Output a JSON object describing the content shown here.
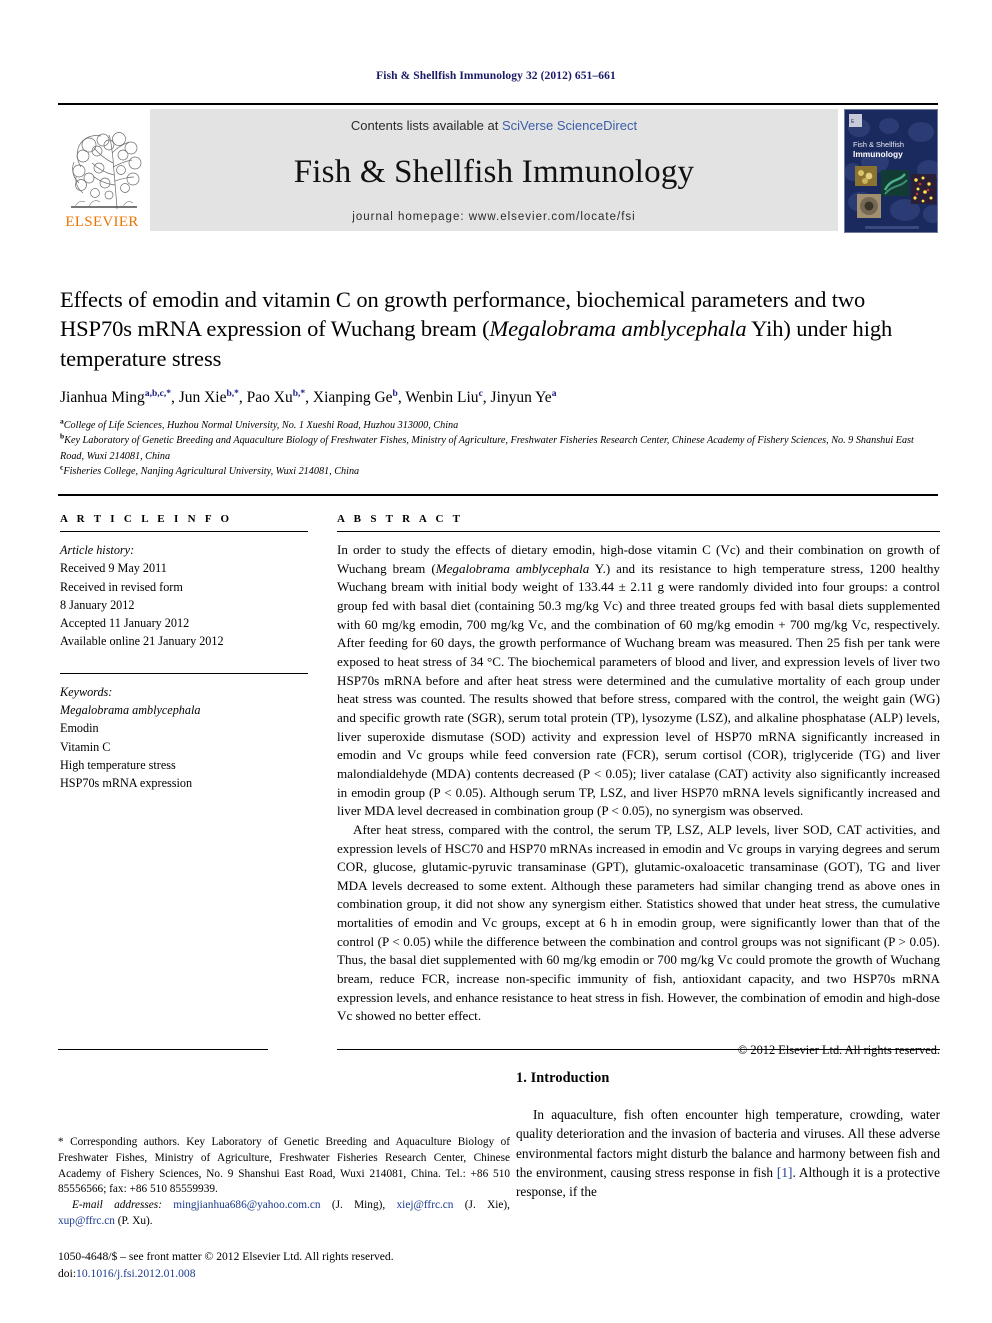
{
  "running_head": "Fish & Shellfish Immunology 32 (2012) 651–661",
  "masthead": {
    "publisher_name": "ELSEVIER",
    "contents_prefix": "Contents lists available at ",
    "contents_link": "SciVerse ScienceDirect",
    "journal_title": "Fish & Shellfish Immunology",
    "homepage_label": "journal homepage: www.elsevier.com/locate/fsi",
    "cover_title_line1": "Fish & Shellfish",
    "cover_title_line2": "Immunology"
  },
  "title": {
    "line1": "Effects of emodin and vitamin C on growth performance, biochemical parameters",
    "line2_pre": "and two HSP70s mRNA expression of Wuchang bream (",
    "line2_italic": "Megalobrama",
    "line3_italic": "amblycephala",
    "line3_post": " Yih) under high temperature stress"
  },
  "authors": [
    {
      "name": "Jianhua Ming",
      "sup": "a,b,c,*"
    },
    {
      "name": "Jun Xie",
      "sup": "b,*"
    },
    {
      "name": "Pao Xu",
      "sup": "b,*"
    },
    {
      "name": "Xianping Ge",
      "sup": "b"
    },
    {
      "name": "Wenbin Liu",
      "sup": "c"
    },
    {
      "name": "Jinyun Ye",
      "sup": "a"
    }
  ],
  "affiliations": [
    {
      "mark": "a",
      "text": "College of Life Sciences, Huzhou Normal University, No. 1 Xueshi Road, Huzhou 313000, China"
    },
    {
      "mark": "b",
      "text": "Key Laboratory of Genetic Breeding and Aquaculture Biology of Freshwater Fishes, Ministry of Agriculture, Freshwater Fisheries Research Center, Chinese Academy of Fishery Sciences, No. 9 Shanshui East Road, Wuxi 214081, China"
    },
    {
      "mark": "c",
      "text": "Fisheries College, Nanjing Agricultural University, Wuxi 214081, China"
    }
  ],
  "article_info": {
    "heading": "A R T I C L E   I N F O",
    "history_label": "Article history:",
    "history": [
      "Received 9 May 2011",
      "Received in revised form",
      "8 January 2012",
      "Accepted 11 January 2012",
      "Available online 21 January 2012"
    ],
    "keywords_label": "Keywords:",
    "keywords": [
      "Megalobrama amblycephala",
      "Emodin",
      "Vitamin C",
      "High temperature stress",
      "HSP70s mRNA expression"
    ]
  },
  "abstract": {
    "heading": "A B S T R A C T",
    "para1_a": "In order to study the effects of dietary emodin, high-dose vitamin C (Vc) and their combination on growth of Wuchang bream (",
    "para1_italic": "Megalobrama amblycephala",
    "para1_b": " Y.) and its resistance to high temperature stress, 1200 healthy Wuchang bream with initial body weight of 133.44 ± 2.11 g were randomly divided into four groups: a control group fed with basal diet (containing 50.3 mg/kg Vc) and three treated groups fed with basal diets supplemented with 60 mg/kg emodin, 700 mg/kg Vc, and the combination of 60 mg/kg emodin + 700 mg/kg Vc, respectively. After feeding for 60 days, the growth performance of Wuchang bream was measured. Then 25 fish per tank were exposed to heat stress of 34 °C. The biochemical parameters of blood and liver, and expression levels of liver two HSP70s mRNA before and after heat stress were determined and the cumulative mortality of each group under heat stress was counted. The results showed that before stress, compared with the control, the weight gain (WG) and specific growth rate (SGR), serum total protein (TP), lysozyme (LSZ), and alkaline phosphatase (ALP) levels, liver superoxide dismutase (SOD) activity and expression level of HSP70 mRNA significantly increased in emodin and Vc groups while feed conversion rate (FCR), serum cortisol (COR), triglyceride (TG) and liver malondialdehyde (MDA) contents decreased (P < 0.05); liver catalase (CAT) activity also significantly increased in emodin group (P < 0.05). Although serum TP, LSZ, and liver HSP70 mRNA levels significantly increased and liver MDA level decreased in combination group (P < 0.05), no synergism was observed.",
    "para2": "After heat stress, compared with the control, the serum TP, LSZ, ALP levels, liver SOD, CAT activities, and expression levels of HSC70 and HSP70 mRNAs increased in emodin and Vc groups in varying degrees and serum COR, glucose, glutamic-pyruvic transaminase (GPT), glutamic-oxaloacetic transaminase (GOT), TG and liver MDA levels decreased to some extent. Although these parameters had similar changing trend as above ones in combination group, it did not show any synergism either. Statistics showed that under heat stress, the cumulative mortalities of emodin and Vc groups, except at 6 h in emodin group, were significantly lower than that of the control (P < 0.05) while the difference between the combination and control groups was not significant (P > 0.05). Thus, the basal diet supplemented with 60 mg/kg emodin or 700 mg/kg Vc could promote the growth of Wuchang bream, reduce FCR, increase non-specific immunity of fish, antioxidant capacity, and two HSP70s mRNA expression levels, and enhance resistance to heat stress in fish. However, the combination of emodin and high-dose Vc showed no better effect.",
    "copyright": "© 2012 Elsevier Ltd. All rights reserved."
  },
  "footnotes": {
    "corresponding": "* Corresponding authors. Key Laboratory of Genetic Breeding and Aquaculture Biology of Freshwater Fishes, Ministry of Agriculture, Freshwater Fisheries Research Center, Chinese Academy of Fishery Sciences, No. 9 Shanshui East Road, Wuxi 214081, China. Tel.: +86 510 85556566; fax: +86 510 85559939.",
    "email_label": "E-mail addresses:",
    "emails": [
      {
        "address": "mingjianhua686@yahoo.com.cn",
        "person": "(J. Ming)"
      },
      {
        "address": "xiej@ffrc.cn",
        "person": "(J. Xie)"
      },
      {
        "address": "xup@ffrc.cn",
        "person": "(P. Xu)."
      }
    ],
    "frontmatter_line": "1050-4648/$ – see front matter © 2012 Elsevier Ltd. All rights reserved.",
    "doi_label": "doi:",
    "doi_value": "10.1016/j.fsi.2012.01.008"
  },
  "introduction": {
    "heading": "1. Introduction",
    "para_a": "In aquaculture, fish often encounter high temperature, crowding, water quality deterioration and the invasion of bacteria and viruses. All these adverse environmental factors might disturb the balance and harmony between fish and the environment, causing stress response in fish ",
    "ref": "[1]",
    "para_b": ". Although it is a protective response, if the"
  },
  "colors": {
    "running_head": "#1a1a66",
    "link": "#3b5ea8",
    "elsevier_orange": "#ec7404",
    "band_gray": "#e3e3e3",
    "cover_navy": "#1b2a5e"
  }
}
